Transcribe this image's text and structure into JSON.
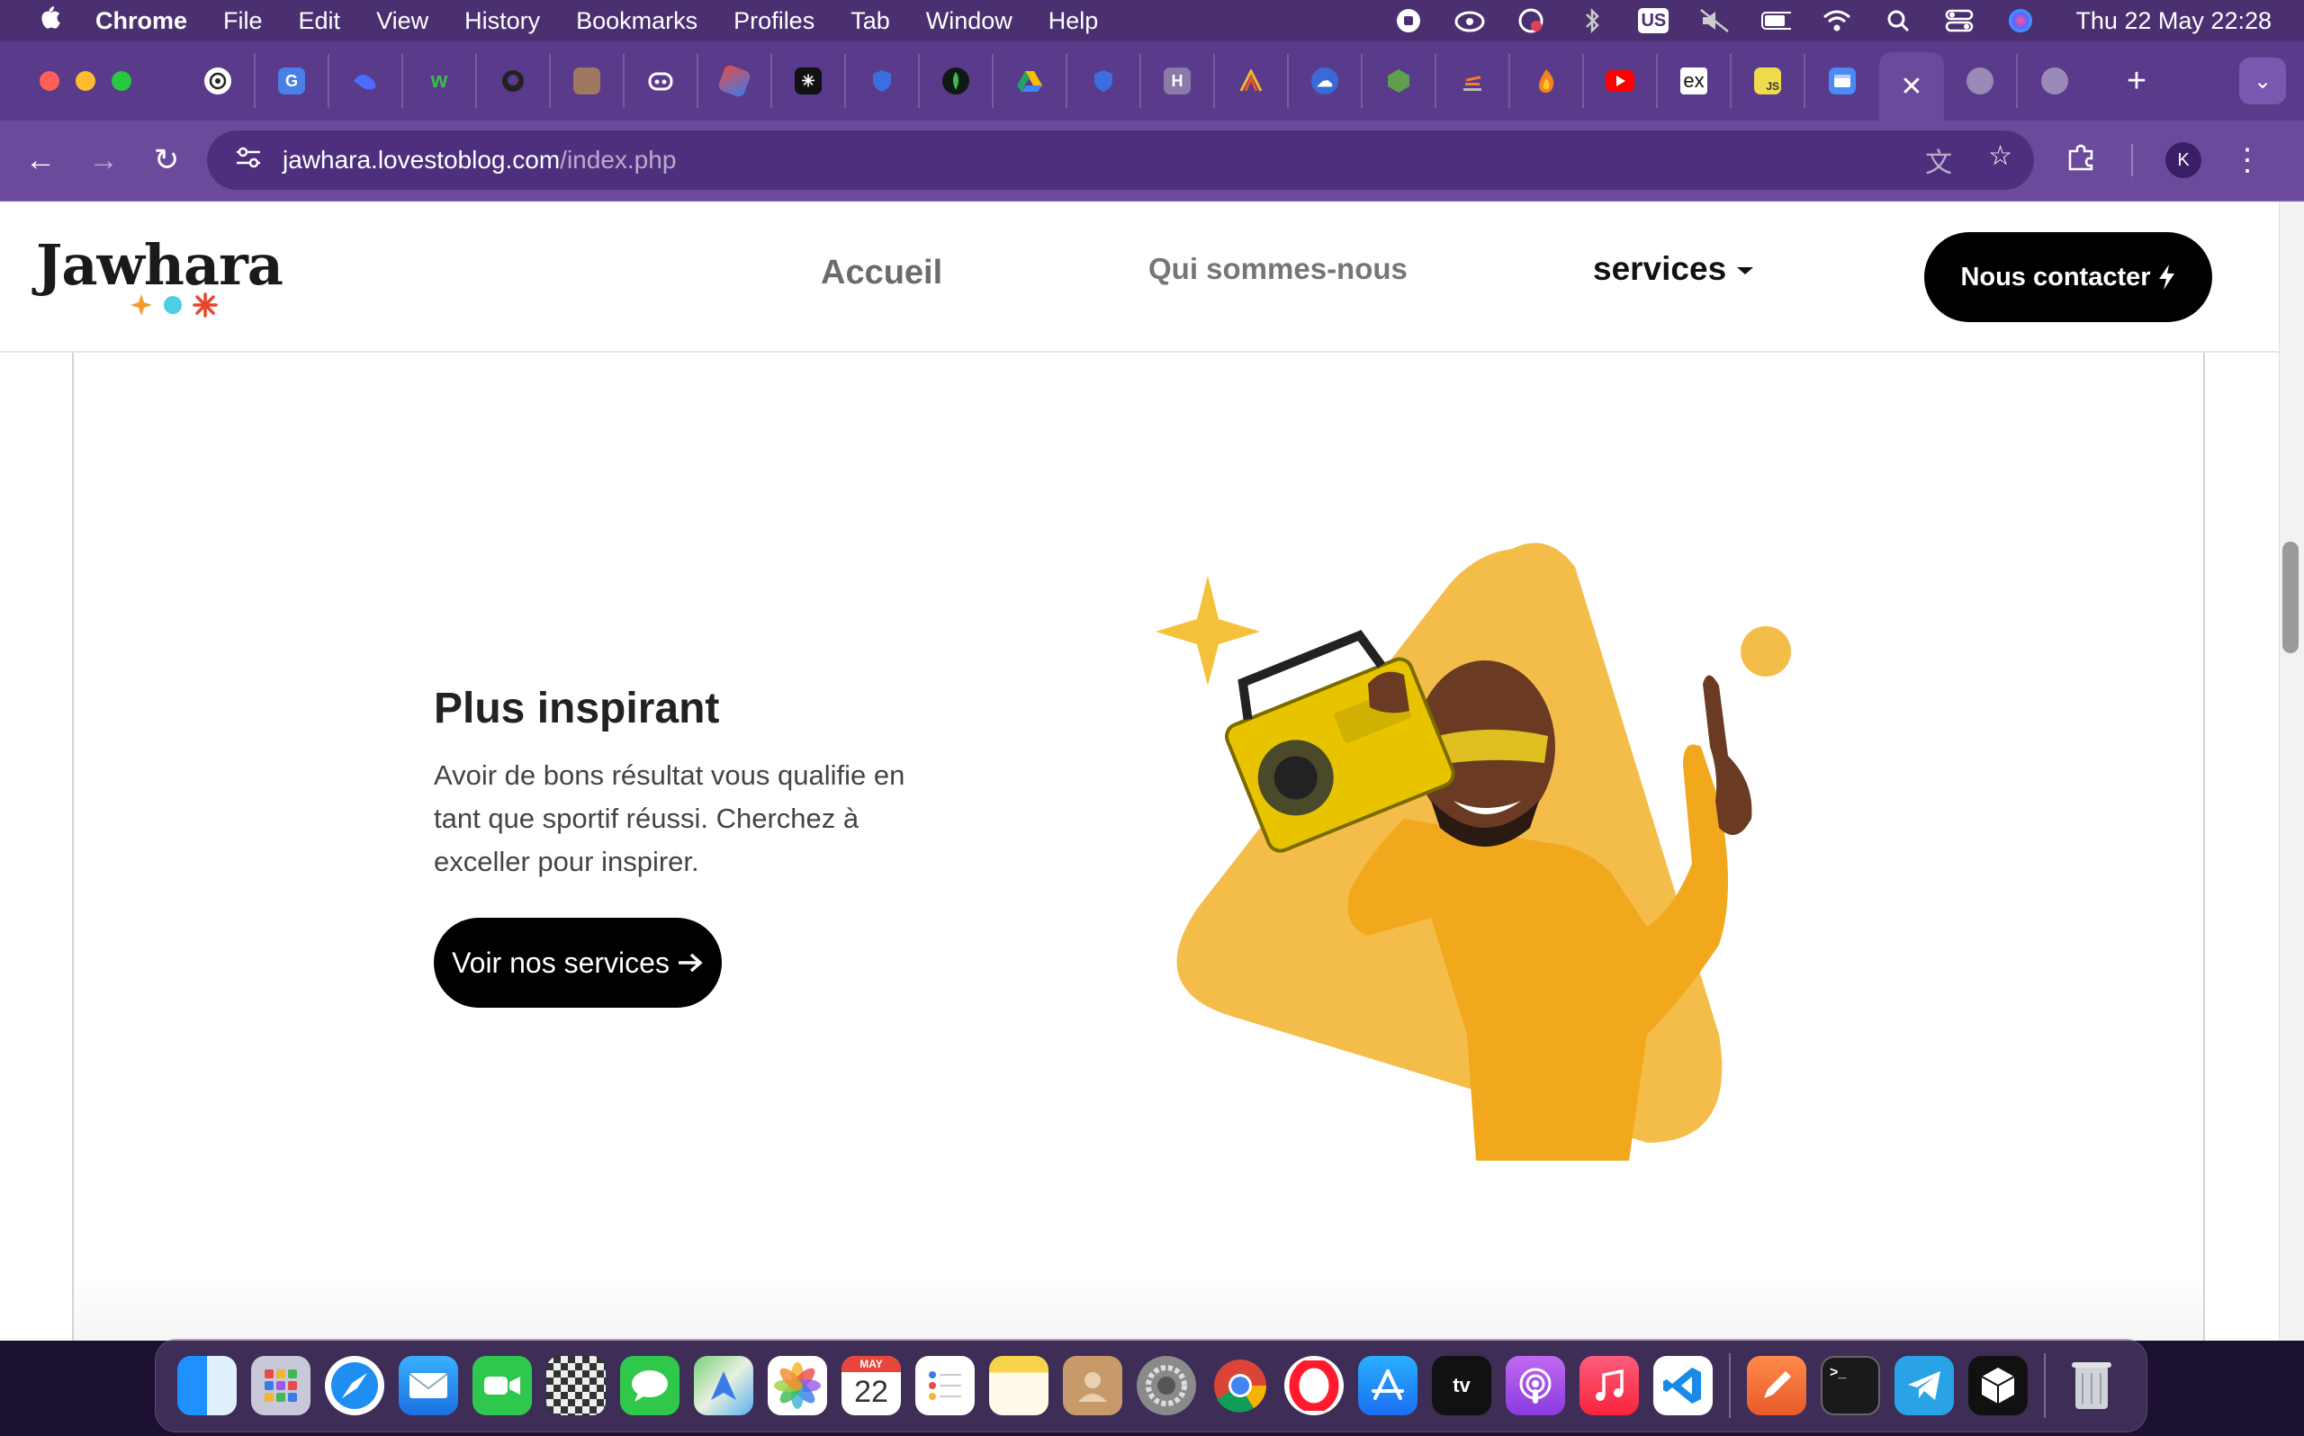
{
  "menubar": {
    "app_name": "Chrome",
    "menus": [
      "File",
      "Edit",
      "View",
      "History",
      "Bookmarks",
      "Profiles",
      "Tab",
      "Window",
      "Help"
    ],
    "keyboard_badge": "US",
    "clock": "Thu 22 May  22:28"
  },
  "tabbar": {
    "tab_icons": [
      "openai-icon",
      "google-translate-icon",
      "deepseek-icon",
      "w-icon",
      "github-icon",
      "avatar-icon",
      "copilot-icon",
      "3d-cube-icon",
      "perplexity-icon",
      "shield-icon",
      "mongodb-icon",
      "google-drive-icon",
      "shield-icon",
      "h-icon",
      "bars-icon",
      "cloud-icon",
      "node-icon",
      "stack-icon",
      "fire-icon",
      "youtube-icon",
      "ex-icon",
      "js-icon",
      "window-icon"
    ],
    "ex_fav_label": "ex",
    "js_fav_label": "JS",
    "h_fav_label": "H"
  },
  "toolbar": {
    "url_host": "jawhara.lovestoblog.com",
    "url_path": "/index.php",
    "profile_initial": "K"
  },
  "site": {
    "logo": "Jawhara",
    "nav": {
      "home": "Accueil",
      "about": "Qui sommes-nous",
      "services": "services",
      "contact": "Nous contacter"
    },
    "hero": {
      "title": "Plus inspirant",
      "description": "Avoir de bons résultat vous qualifie en tant que sportif réussi. Cherchez à exceller pour inspirer.",
      "button": "Voir nos services"
    },
    "colors": {
      "accent_yellow": "#f4bd4a",
      "star_yellow": "#f5c13a",
      "logo_star_orange": "#f29a2e",
      "logo_dot_cyan": "#4ccfe0",
      "logo_asterisk_red": "#e8452c",
      "button_black": "#000000"
    }
  },
  "dock": {
    "apps": [
      "finder",
      "launchpad",
      "safari",
      "mail",
      "facetime",
      "chess",
      "messages",
      "maps",
      "photos",
      "calendar",
      "reminders",
      "notes",
      "contacts",
      "system-settings",
      "chrome",
      "opera",
      "app-store",
      "apple-tv",
      "podcasts",
      "music",
      "vscode",
      "pencil",
      "terminal",
      "telegram",
      "cube",
      "trash"
    ],
    "calendar_month": "MAY",
    "calendar_day": "22",
    "tv_label": "tv"
  }
}
